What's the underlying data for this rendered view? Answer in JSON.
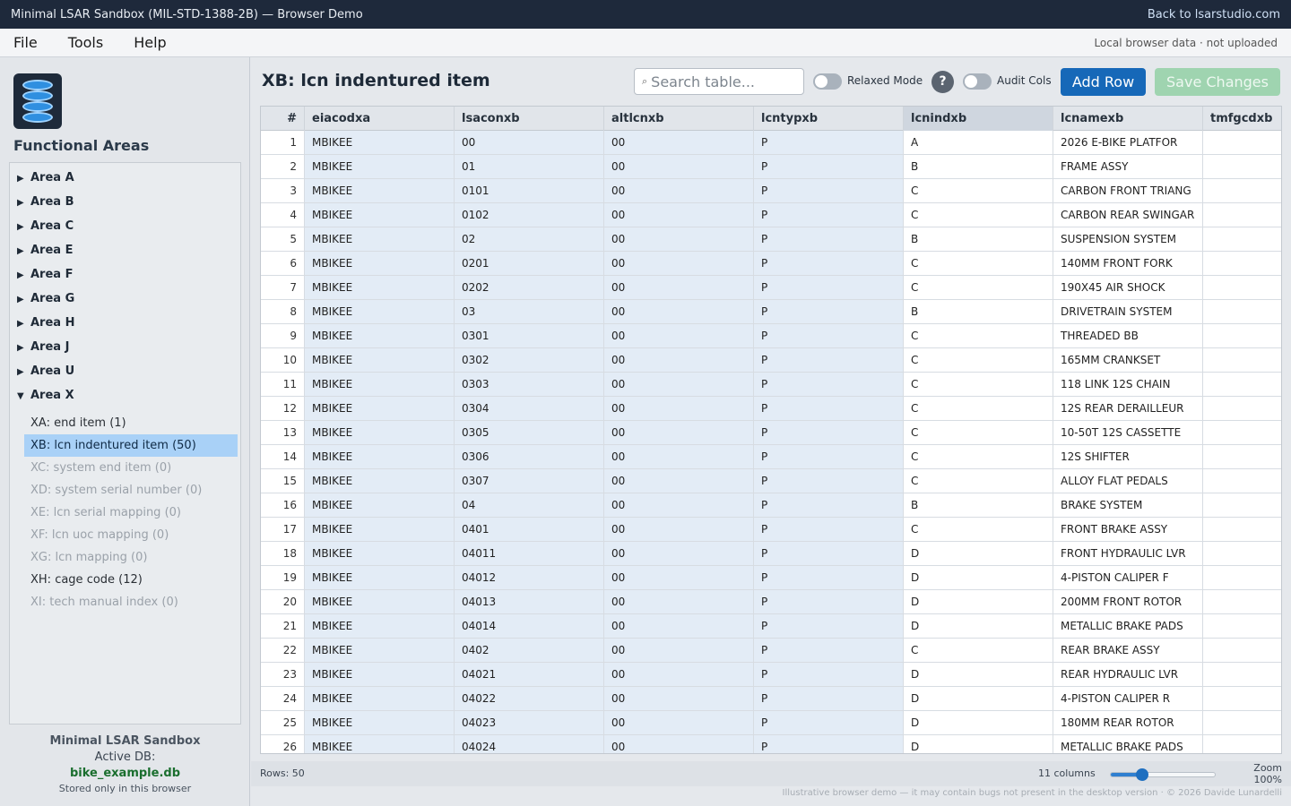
{
  "window": {
    "title": "Minimal LSAR Sandbox (MIL-STD-1388-2B) — Browser Demo",
    "back_link": "Back to lsarstudio.com"
  },
  "menu": {
    "items": [
      "File",
      "Tools",
      "Help"
    ],
    "status": "Local browser data · not uploaded"
  },
  "sidebar": {
    "logo_icon": "database-icon",
    "heading": "Functional Areas",
    "areas": [
      {
        "label": "Area A",
        "expanded": false
      },
      {
        "label": "Area B",
        "expanded": false
      },
      {
        "label": "Area C",
        "expanded": false
      },
      {
        "label": "Area E",
        "expanded": false
      },
      {
        "label": "Area F",
        "expanded": false
      },
      {
        "label": "Area G",
        "expanded": false
      },
      {
        "label": "Area H",
        "expanded": false
      },
      {
        "label": "Area J",
        "expanded": false
      },
      {
        "label": "Area U",
        "expanded": false
      },
      {
        "label": "Area X",
        "expanded": true
      }
    ],
    "tables": [
      {
        "label": "XA: end item (1)",
        "state": "normal"
      },
      {
        "label": "XB: lcn indentured item (50)",
        "state": "selected"
      },
      {
        "label": "XC: system end item (0)",
        "state": "empty"
      },
      {
        "label": "XD: system serial number (0)",
        "state": "empty"
      },
      {
        "label": "XE: lcn serial mapping (0)",
        "state": "empty"
      },
      {
        "label": "XF: lcn uoc mapping (0)",
        "state": "empty"
      },
      {
        "label": "XG: lcn mapping (0)",
        "state": "empty"
      },
      {
        "label": "XH: cage code (12)",
        "state": "normal"
      },
      {
        "label": "XI: tech manual index (0)",
        "state": "empty"
      }
    ],
    "footer": {
      "app_name": "Minimal LSAR Sandbox",
      "active_db_label": "Active DB:",
      "db_name": "bike_example.db",
      "storage_note": "Stored only in this browser"
    }
  },
  "main": {
    "title": "XB: lcn indentured item",
    "search_placeholder": "Search table...",
    "relaxed_mode_label": "Relaxed Mode",
    "relaxed_mode_on": false,
    "help_label": "?",
    "audit_cols_label": "Audit Cols",
    "audit_cols_on": false,
    "add_row_label": "Add Row",
    "save_changes_label": "Save Changes"
  },
  "table": {
    "columns": [
      "#",
      "eiacodxa",
      "lsaconxb",
      "altlcnxb",
      "lcntypxb",
      "lcnindxb",
      "lcnamexb",
      "tmfgcdxb"
    ],
    "sorted_column": "lcnindxb",
    "rows": [
      [
        "1",
        "MBIKEE",
        "00",
        "00",
        "P",
        "A",
        "2026 E-BIKE PLATFOR",
        ""
      ],
      [
        "2",
        "MBIKEE",
        "01",
        "00",
        "P",
        "B",
        "FRAME ASSY",
        ""
      ],
      [
        "3",
        "MBIKEE",
        "0101",
        "00",
        "P",
        "C",
        "CARBON FRONT TRIANG",
        ""
      ],
      [
        "4",
        "MBIKEE",
        "0102",
        "00",
        "P",
        "C",
        "CARBON REAR SWINGAR",
        ""
      ],
      [
        "5",
        "MBIKEE",
        "02",
        "00",
        "P",
        "B",
        "SUSPENSION SYSTEM",
        ""
      ],
      [
        "6",
        "MBIKEE",
        "0201",
        "00",
        "P",
        "C",
        "140MM FRONT FORK",
        ""
      ],
      [
        "7",
        "MBIKEE",
        "0202",
        "00",
        "P",
        "C",
        "190X45 AIR SHOCK",
        ""
      ],
      [
        "8",
        "MBIKEE",
        "03",
        "00",
        "P",
        "B",
        "DRIVETRAIN SYSTEM",
        ""
      ],
      [
        "9",
        "MBIKEE",
        "0301",
        "00",
        "P",
        "C",
        "THREADED BB",
        ""
      ],
      [
        "10",
        "MBIKEE",
        "0302",
        "00",
        "P",
        "C",
        "165MM CRANKSET",
        ""
      ],
      [
        "11",
        "MBIKEE",
        "0303",
        "00",
        "P",
        "C",
        "118 LINK 12S CHAIN",
        ""
      ],
      [
        "12",
        "MBIKEE",
        "0304",
        "00",
        "P",
        "C",
        "12S REAR DERAILLEUR",
        ""
      ],
      [
        "13",
        "MBIKEE",
        "0305",
        "00",
        "P",
        "C",
        "10-50T 12S CASSETTE",
        ""
      ],
      [
        "14",
        "MBIKEE",
        "0306",
        "00",
        "P",
        "C",
        "12S SHIFTER",
        ""
      ],
      [
        "15",
        "MBIKEE",
        "0307",
        "00",
        "P",
        "C",
        "ALLOY FLAT PEDALS",
        ""
      ],
      [
        "16",
        "MBIKEE",
        "04",
        "00",
        "P",
        "B",
        "BRAKE SYSTEM",
        ""
      ],
      [
        "17",
        "MBIKEE",
        "0401",
        "00",
        "P",
        "C",
        "FRONT BRAKE ASSY",
        ""
      ],
      [
        "18",
        "MBIKEE",
        "04011",
        "00",
        "P",
        "D",
        "FRONT HYDRAULIC LVR",
        ""
      ],
      [
        "19",
        "MBIKEE",
        "04012",
        "00",
        "P",
        "D",
        "4-PISTON CALIPER F",
        ""
      ],
      [
        "20",
        "MBIKEE",
        "04013",
        "00",
        "P",
        "D",
        "200MM FRONT ROTOR",
        ""
      ],
      [
        "21",
        "MBIKEE",
        "04014",
        "00",
        "P",
        "D",
        "METALLIC BRAKE PADS",
        ""
      ],
      [
        "22",
        "MBIKEE",
        "0402",
        "00",
        "P",
        "C",
        "REAR BRAKE ASSY",
        ""
      ],
      [
        "23",
        "MBIKEE",
        "04021",
        "00",
        "P",
        "D",
        "REAR HYDRAULIC LVR",
        ""
      ],
      [
        "24",
        "MBIKEE",
        "04022",
        "00",
        "P",
        "D",
        "4-PISTON CALIPER R",
        ""
      ],
      [
        "25",
        "MBIKEE",
        "04023",
        "00",
        "P",
        "D",
        "180MM REAR ROTOR",
        ""
      ],
      [
        "26",
        "MBIKEE",
        "04024",
        "00",
        "P",
        "D",
        "METALLIC BRAKE PADS",
        ""
      ]
    ]
  },
  "statusbar": {
    "rows_label": "Rows: 50",
    "columns_label": "11 columns",
    "zoom_label": "Zoom",
    "zoom_value": "100%",
    "zoom_fraction": 0.3
  },
  "footnote": "Illustrative browser demo — it may contain bugs not present in the desktop version · © 2026 Davide Lunardelli",
  "colors": {
    "accent": "#1668b8",
    "save_disabled": "#9fd4b0",
    "selected_item": "#a9d1f7",
    "titlebar": "#1e293b"
  }
}
